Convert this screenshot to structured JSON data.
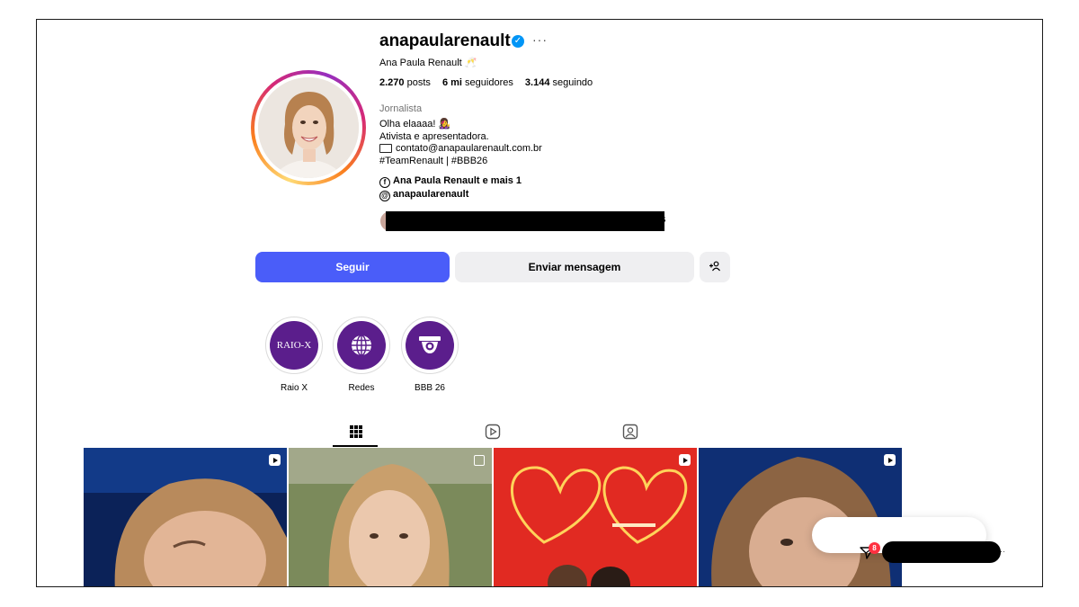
{
  "profile": {
    "username": "anapaularenault",
    "more_glyph": "···",
    "full_name": "Ana Paula Renault 🥂",
    "stats": {
      "posts_value": "2.270",
      "posts_label": "posts",
      "followers_value": "6 mi",
      "followers_label": "seguidores",
      "following_value": "3.144",
      "following_label": "seguindo"
    },
    "category": "Jornalista",
    "bio": {
      "line1": "Olha elaaaa! 👩‍🎤",
      "line2": "Ativista e apresentadora.",
      "line3_email": "contato@anapaularenault.com.br",
      "line4": "#TeamRenault | #BBB26"
    },
    "links": {
      "facebook_icon_glyph": "f",
      "facebook_text": "Ana Paula Renault e mais 1",
      "threads_icon_glyph": "@",
      "threads_text": "anapaularenault"
    },
    "followed_by_suffix": "s"
  },
  "actions": {
    "follow_label": "Seguir",
    "message_label": "Enviar mensagem",
    "add_user_glyph": "+👤"
  },
  "highlights": [
    {
      "label": "Raio X",
      "cover_text": "RAIO-X"
    },
    {
      "label": "Redes"
    },
    {
      "label": "BBB 26"
    }
  ],
  "tabs": [
    "posts-grid",
    "reels",
    "tagged"
  ],
  "messages_badge": "8",
  "colors": {
    "follow_button": "#4a5df9",
    "secondary_button": "#efeff1",
    "highlight_purple": "#5b1e8c",
    "verified_blue": "#0095f6",
    "badge_red": "#ff3040"
  }
}
